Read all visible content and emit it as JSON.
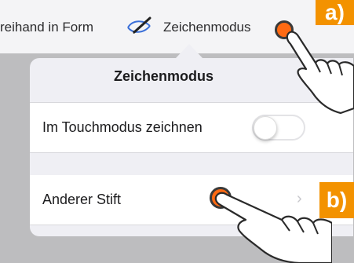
{
  "toolbar": {
    "freehand_label": "reihand in Form",
    "mode_label": "Zeichenmodus",
    "pen_icon": "pen-eye-icon"
  },
  "popover": {
    "title": "Zeichenmodus",
    "rows": [
      {
        "label": "Im Touchmodus zeichnen",
        "control": "toggle",
        "toggle_on": false
      },
      {
        "label": "Anderer Stift",
        "control": "chevron",
        "chevron": "›"
      }
    ]
  },
  "annotations": {
    "a": "a)",
    "b": "b)",
    "accent": "#f39200",
    "dot_color": "#ff6a13"
  }
}
